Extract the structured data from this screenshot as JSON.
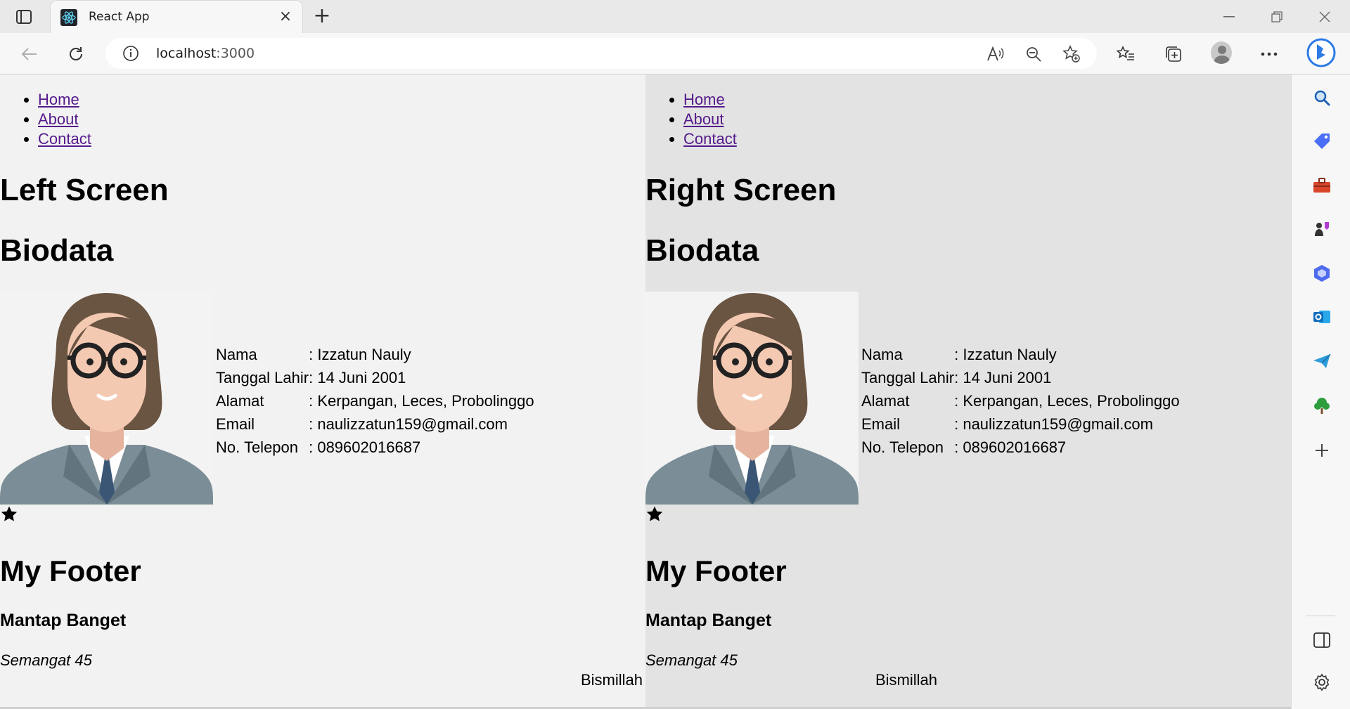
{
  "browser": {
    "tab_title": "React App",
    "url_host": "localhost",
    "url_port": ":3000"
  },
  "left": {
    "nav": [
      "Home",
      "About",
      "Contact"
    ],
    "screen_title": "Left Screen",
    "biodata_title": "Biodata",
    "fields": [
      {
        "label": "Nama",
        "value": ": Izzatun Nauly"
      },
      {
        "label": "Tanggal Lahir",
        "value": ": 14 Juni 2001"
      },
      {
        "label": "Alamat",
        "value": ": Kerpangan, Leces, Probolinggo"
      },
      {
        "label": "Email",
        "value": ": naulizzatun159@gmail.com"
      },
      {
        "label": "No. Telepon",
        "value": ": 089602016687"
      }
    ],
    "footer_title": "My Footer",
    "footer_subtitle": "Mantap Banget",
    "footer_italic": "Semangat 45",
    "footer_text": "Bismillah"
  },
  "right": {
    "nav": [
      "Home",
      "About",
      "Contact"
    ],
    "screen_title": "Right Screen",
    "biodata_title": "Biodata",
    "fields": [
      {
        "label": "Nama",
        "value": ": Izzatun Nauly"
      },
      {
        "label": "Tanggal Lahir",
        "value": ": 14 Juni 2001"
      },
      {
        "label": "Alamat",
        "value": ": Kerpangan, Leces, Probolinggo"
      },
      {
        "label": "Email",
        "value": ": naulizzatun159@gmail.com"
      },
      {
        "label": "No. Telepon",
        "value": ": 089602016687"
      }
    ],
    "footer_title": "My Footer",
    "footer_subtitle": "Mantap Banget",
    "footer_italic": "Semangat 45",
    "footer_text": "Bismillah"
  },
  "icons": {
    "sidebar": [
      "search-icon",
      "tag-icon",
      "toolbox-icon",
      "games-icon",
      "office-icon",
      "outlook-icon",
      "send-icon",
      "tree-icon",
      "add-icon",
      "split-screen-icon",
      "settings-icon"
    ]
  }
}
